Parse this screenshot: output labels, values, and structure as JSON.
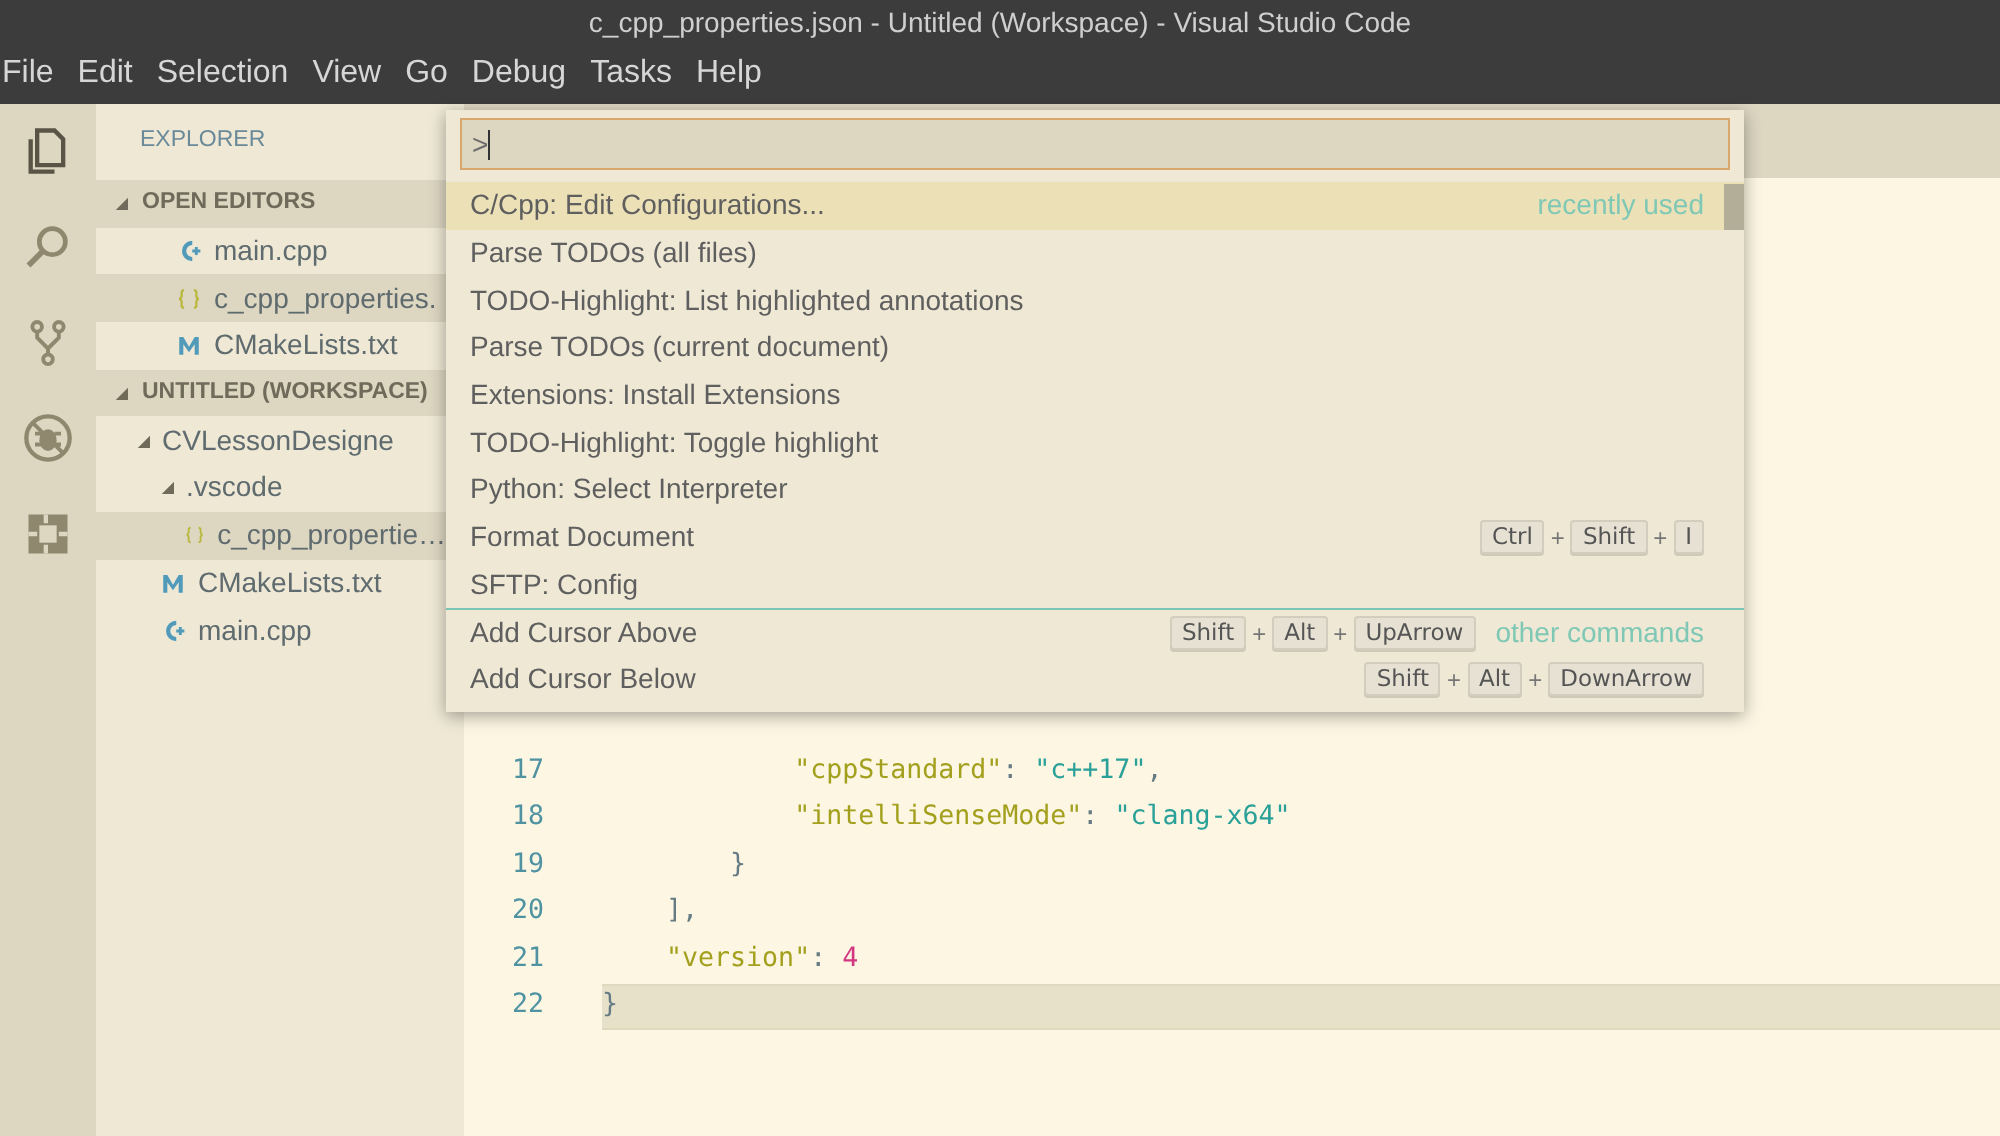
{
  "window": {
    "title": "c_cpp_properties.json - Untitled (Workspace) - Visual Studio Code"
  },
  "menu": [
    "File",
    "Edit",
    "Selection",
    "View",
    "Go",
    "Debug",
    "Tasks",
    "Help"
  ],
  "activity_bar": [
    {
      "kind": "files",
      "selected": true
    },
    {
      "kind": "search",
      "selected": false
    },
    {
      "kind": "git",
      "selected": false
    },
    {
      "kind": "debug",
      "selected": false
    },
    {
      "kind": "extensions",
      "selected": false
    }
  ],
  "sidebar": {
    "title": "EXPLORER",
    "sections": [
      {
        "title": "OPEN EDITORS",
        "expanded": true,
        "items": [
          {
            "label": "main.cpp",
            "kind": "cpp",
            "selected": false
          },
          {
            "label": "c_cpp_properties.",
            "kind": "json",
            "selected": true
          },
          {
            "label": "CMakeLists.txt",
            "kind": "cmake",
            "selected": false
          }
        ]
      },
      {
        "title": "UNTITLED (WORKSPACE)",
        "expanded": true,
        "items": [
          {
            "label": "CVLessonDesigne",
            "kind": "folder",
            "expanded": true,
            "selected": false,
            "children": [
              {
                "label": ".vscode",
                "kind": "folder",
                "expanded": true,
                "selected": false,
                "children": [
                  {
                    "label": "c_cpp_propertie…",
                    "kind": "json",
                    "selected": true
                  }
                ]
              },
              {
                "label": "CMakeLists.txt",
                "kind": "cmake",
                "selected": false
              },
              {
                "label": "main.cpp",
                "kind": "cpp",
                "selected": false
              }
            ]
          }
        ]
      }
    ]
  },
  "command_palette": {
    "input": {
      "value": ">"
    },
    "items": [
      {
        "label": "C/Cpp: Edit Configurations...",
        "selected": true,
        "separator": false,
        "hint": "recently used"
      },
      {
        "label": "Parse TODOs (all files)",
        "selected": false,
        "separator": false
      },
      {
        "label": "TODO-Highlight: List highlighted annotations",
        "selected": false,
        "separator": false
      },
      {
        "label": "Parse TODOs (current document)",
        "selected": false,
        "separator": false
      },
      {
        "label": "Extensions: Install Extensions",
        "selected": false,
        "separator": false
      },
      {
        "label": "TODO-Highlight: Toggle highlight",
        "selected": false,
        "separator": false
      },
      {
        "label": "Python: Select Interpreter",
        "selected": false,
        "separator": false
      },
      {
        "label": "Format Document",
        "selected": false,
        "separator": false,
        "keys": [
          "Ctrl",
          "+",
          "Shift",
          "+",
          "I"
        ]
      },
      {
        "label": "SFTP: Config",
        "selected": false,
        "separator": false
      },
      {
        "label": "Add Cursor Above",
        "selected": false,
        "separator": true,
        "keys": [
          "Shift",
          "+",
          "Alt",
          "+",
          "UpArrow"
        ],
        "hint": "other commands"
      },
      {
        "label": "Add Cursor Below",
        "selected": false,
        "separator": false,
        "keys": [
          "Shift",
          "+",
          "Alt",
          "+",
          "DownArrow"
        ]
      }
    ]
  },
  "editor": {
    "lines": [
      {
        "number": "17",
        "current": false,
        "tokens": [
          {
            "kind": "key",
            "text": "            \"cppStandard\""
          },
          {
            "kind": "punct",
            "text": ": "
          },
          {
            "kind": "string",
            "text": "\"c++17\""
          },
          {
            "kind": "punct",
            "text": ","
          }
        ]
      },
      {
        "number": "18",
        "current": false,
        "tokens": [
          {
            "kind": "key",
            "text": "            \"intelliSenseMode\""
          },
          {
            "kind": "punct",
            "text": ": "
          },
          {
            "kind": "string",
            "text": "\"clang-x64\""
          }
        ]
      },
      {
        "number": "19",
        "current": false,
        "tokens": [
          {
            "kind": "punct",
            "text": "        }"
          }
        ]
      },
      {
        "number": "20",
        "current": false,
        "tokens": [
          {
            "kind": "punct",
            "text": "    ],"
          }
        ]
      },
      {
        "number": "21",
        "current": false,
        "tokens": [
          {
            "kind": "key",
            "text": "    \"version\""
          },
          {
            "kind": "punct",
            "text": ": "
          },
          {
            "kind": "number",
            "text": "4"
          }
        ]
      },
      {
        "number": "22",
        "current": true,
        "tokens": [
          {
            "kind": "punct",
            "text": "}"
          }
        ]
      }
    ]
  }
}
